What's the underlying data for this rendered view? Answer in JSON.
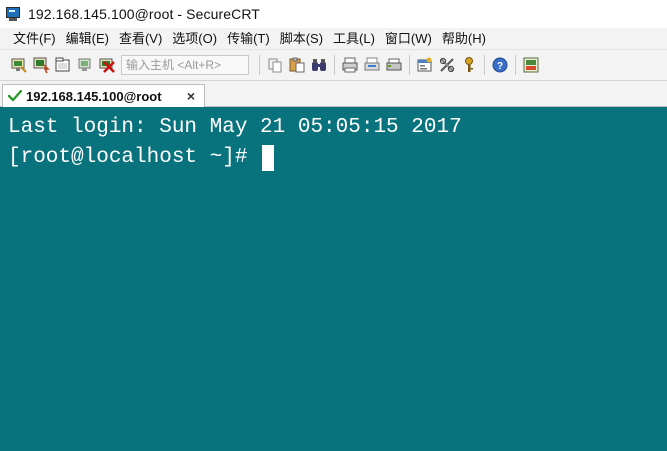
{
  "window": {
    "title": "192.168.145.100@root - SecureCRT"
  },
  "menu": {
    "items": [
      {
        "label": "文件(F)"
      },
      {
        "label": "编辑(E)"
      },
      {
        "label": "查看(V)"
      },
      {
        "label": "选项(O)"
      },
      {
        "label": "传输(T)"
      },
      {
        "label": "脚本(S)"
      },
      {
        "label": "工具(L)"
      },
      {
        "label": "窗口(W)"
      },
      {
        "label": "帮助(H)"
      }
    ]
  },
  "toolbar": {
    "quick_connect_placeholder": "输入主机 <Alt+R>",
    "icons": [
      "connect-icon",
      "quick-connect-icon",
      "connect-in-tab-icon",
      "reconnect-icon",
      "disconnect-icon",
      "copy-icon",
      "paste-icon",
      "find-icon",
      "print-icon",
      "print-selection-icon",
      "print-setup-icon",
      "session-options-icon",
      "global-options-icon",
      "keymap-icon",
      "help-icon",
      "sftp-icon"
    ]
  },
  "tabs": [
    {
      "label": "192.168.145.100@root",
      "close": "×",
      "status_icon": "connected-check-icon"
    }
  ],
  "terminal": {
    "background": "#08737d",
    "foreground": "#ffffff",
    "lines": [
      "Last login: Sun May 21 05:05:15 2017",
      "[root@localhost ~]# "
    ]
  }
}
